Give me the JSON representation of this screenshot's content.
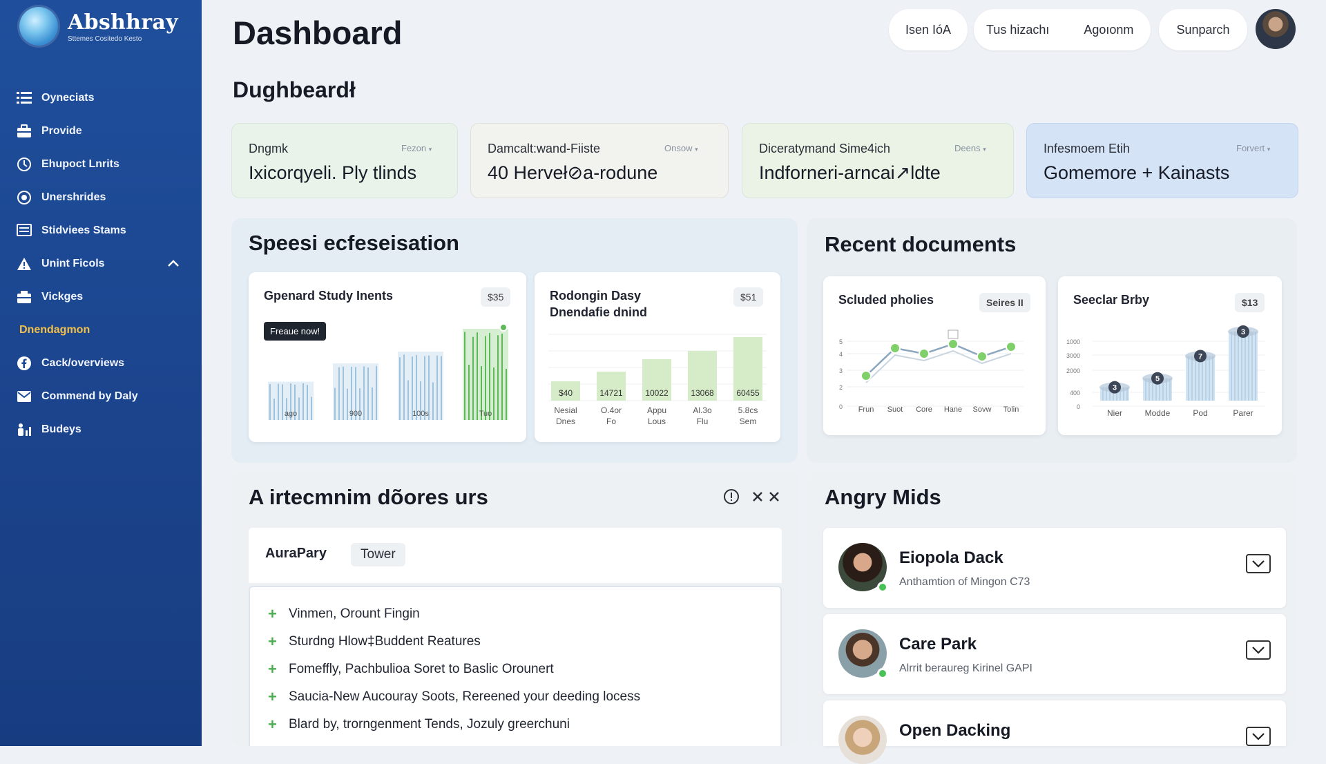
{
  "app": {
    "name": "Abshhray",
    "tagline": "Sttemes Cositedo Kesto"
  },
  "sidebar": {
    "items": [
      {
        "label": "Oyneciats",
        "icon": "list-icon"
      },
      {
        "label": "Provide",
        "icon": "briefcase-icon"
      },
      {
        "label": "Ehupoct Lnrits",
        "icon": "clock-icon"
      },
      {
        "label": "Unershrides",
        "icon": "target-icon"
      },
      {
        "label": "Stidviees Stams",
        "icon": "monitor-icon"
      },
      {
        "label": "Unint Ficols",
        "icon": "warning-icon"
      },
      {
        "label": "Vickges",
        "icon": "package-icon"
      },
      {
        "label": "Dnendagmon",
        "icon": ""
      },
      {
        "label": "Cack/overviews",
        "icon": "facebook-icon"
      },
      {
        "label": "Commend by Daly",
        "icon": "mail-icon"
      },
      {
        "label": "Budeys",
        "icon": "users-chart-icon"
      }
    ]
  },
  "header": {
    "title": "Dashboard",
    "subtitle": "Dughbeardł",
    "actions": [
      {
        "label": "Isen IóA"
      },
      {
        "label": "Tus hizachı"
      },
      {
        "label": "Agoıonm"
      },
      {
        "label": "Sunparch"
      }
    ]
  },
  "stats": [
    {
      "label": "Dngmk",
      "tag": "Fezon",
      "value": "Ixicorqyeli. Ply tlinds"
    },
    {
      "label": "Damcalt:wand-Fiiste",
      "tag": "Onsow",
      "value": "40 Herveł⊘a-rodune"
    },
    {
      "label": "Diceratymand Sime4ich",
      "tag": "Deens",
      "value": "Indforneri-arncai↗ldte"
    },
    {
      "label": "Infesmoem Etih",
      "tag": "Forvert",
      "value": "Gomemore + Kainasts"
    }
  ],
  "specs": {
    "title": "Speesi ecfeseisation",
    "card1": {
      "title": "Gpenard Study Inents",
      "badge": "$35",
      "tooltip": "Freaue now!"
    },
    "card2": {
      "title": "Rodongin Dasy\nDnendafie dnind",
      "badge": "$51"
    }
  },
  "recent": {
    "title": "Recent documents",
    "card1": {
      "title": "Scluded pholies",
      "badge": "Seires II"
    },
    "card2": {
      "title": "Seeclar Brby",
      "badge": "$13"
    }
  },
  "chart_data": [
    {
      "type": "bar",
      "title": "Gpenard Study Inents",
      "categories": [
        "ago",
        "900",
        "100s",
        "Tuo"
      ],
      "series": [
        {
          "values": [
            42,
            62,
            75,
            100
          ]
        }
      ]
    },
    {
      "type": "bar",
      "title": "Rodongin Dasy Dnendafie dnind",
      "categories": [
        "Nesial Dnes",
        "O.4or Fo",
        "Appu Lous",
        "Al.3o Flu",
        "5.8cs Sem"
      ],
      "values": [
        40,
        14721,
        10022,
        13068,
        60455
      ],
      "value_labels": [
        "$40",
        "14721",
        "10022",
        "13068",
        "60455"
      ]
    },
    {
      "type": "line",
      "title": "Scluded pholies",
      "categories": [
        "Frun",
        "Suot",
        "Core",
        "Hane",
        "Sovw",
        "Tolin"
      ],
      "values": [
        2.2,
        4.2,
        3.8,
        4.5,
        3.6,
        4.3
      ],
      "yticks": [
        "0",
        "2",
        "3",
        "4",
        "5"
      ]
    },
    {
      "type": "bar",
      "title": "Seeclar Brby",
      "categories": [
        "Nier",
        "Modde",
        "Pod",
        "Parer"
      ],
      "values": [
        300,
        500,
        1000,
        1550
      ],
      "point_labels": [
        "3",
        "5",
        "7",
        "3"
      ],
      "yticks": [
        "0",
        "400",
        "2000",
        "3000",
        "1000"
      ]
    }
  ],
  "activity": {
    "title": "A irtecmnim dõores urs",
    "tabs": [
      {
        "label": "AuraPary"
      },
      {
        "label": "Tower"
      }
    ],
    "items": [
      "Vinmen, Orount Fingin",
      "Sturdng Hlow‡Buddent Reatures",
      "Fomeffly, Pachbulioa Soret to Baslic Orounert",
      "Saucia-New Aucouray Soots, Rereened your deeding locess",
      "Blard by, trorngenment Tends, Jozuly greerchuni"
    ]
  },
  "people": {
    "title": "Angry Mids",
    "items": [
      {
        "name": "Eiopola Dack",
        "role": "Anthamtion of Mingon C73"
      },
      {
        "name": "Care Park",
        "role": "Alrrit beraureg Kirinel GAPI"
      },
      {
        "name": "Open Dacking",
        "role": ""
      }
    ]
  }
}
